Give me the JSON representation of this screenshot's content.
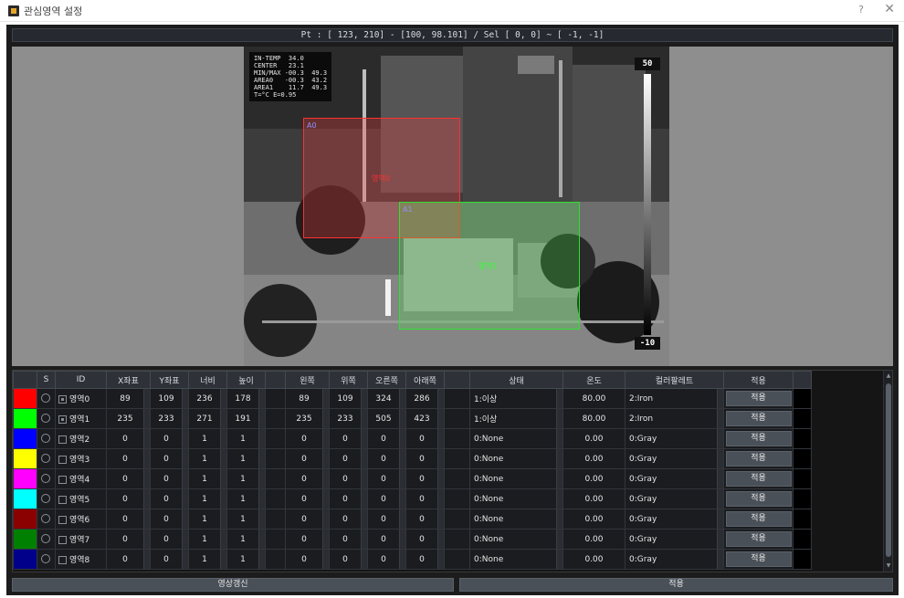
{
  "window": {
    "title": "관심영역 설정",
    "help_label": "?",
    "close_label": "✕"
  },
  "status": {
    "text": "Pt : [ 123, 210] - [100, 98.101] / Sel [   0,   0] ~ [  -1,  -1]"
  },
  "thermal": {
    "overlay_lines": "IN-TEMP  34.0\nCENTER   23.1\nMIN/MAX -00.3  49.3\nAREA0   -00.3  43.2\nAREA1    11.7  49.3\nT=°C E=0.95",
    "scale_max": "50",
    "scale_min": "-10",
    "roi0_label": "영역0",
    "roi1_label": "영역1",
    "roi0_tag": "A0",
    "roi1_tag": "A1"
  },
  "table": {
    "headers": [
      "",
      "S",
      "ID",
      "X좌표",
      "Y좌표",
      "너비",
      "높이",
      "",
      "왼쪽",
      "위쪽",
      "오른쪽",
      "아래쪽",
      "",
      "상태",
      "온도",
      "컬러팔레트",
      "적용",
      ""
    ],
    "rows": [
      {
        "color": "#ff0000",
        "checked": true,
        "id": "영역0",
        "x": "89",
        "y": "109",
        "w": "236",
        "h": "178",
        "left": "89",
        "top": "109",
        "right": "324",
        "bottom": "286",
        "state": "1:이상",
        "temp": "80.00",
        "palette": "2:Iron",
        "apply": "적용"
      },
      {
        "color": "#00ff00",
        "checked": true,
        "id": "영역1",
        "x": "235",
        "y": "233",
        "w": "271",
        "h": "191",
        "left": "235",
        "top": "233",
        "right": "505",
        "bottom": "423",
        "state": "1:이상",
        "temp": "80.00",
        "palette": "2:Iron",
        "apply": "적용"
      },
      {
        "color": "#0000ff",
        "checked": false,
        "id": "영역2",
        "x": "0",
        "y": "0",
        "w": "1",
        "h": "1",
        "left": "0",
        "top": "0",
        "right": "0",
        "bottom": "0",
        "state": "0:None",
        "temp": "0.00",
        "palette": "0:Gray",
        "apply": "적용"
      },
      {
        "color": "#ffff00",
        "checked": false,
        "id": "영역3",
        "x": "0",
        "y": "0",
        "w": "1",
        "h": "1",
        "left": "0",
        "top": "0",
        "right": "0",
        "bottom": "0",
        "state": "0:None",
        "temp": "0.00",
        "palette": "0:Gray",
        "apply": "적용"
      },
      {
        "color": "#ff00ff",
        "checked": false,
        "id": "영역4",
        "x": "0",
        "y": "0",
        "w": "1",
        "h": "1",
        "left": "0",
        "top": "0",
        "right": "0",
        "bottom": "0",
        "state": "0:None",
        "temp": "0.00",
        "palette": "0:Gray",
        "apply": "적용"
      },
      {
        "color": "#00ffff",
        "checked": false,
        "id": "영역5",
        "x": "0",
        "y": "0",
        "w": "1",
        "h": "1",
        "left": "0",
        "top": "0",
        "right": "0",
        "bottom": "0",
        "state": "0:None",
        "temp": "0.00",
        "palette": "0:Gray",
        "apply": "적용"
      },
      {
        "color": "#8b0000",
        "checked": false,
        "id": "영역6",
        "x": "0",
        "y": "0",
        "w": "1",
        "h": "1",
        "left": "0",
        "top": "0",
        "right": "0",
        "bottom": "0",
        "state": "0:None",
        "temp": "0.00",
        "palette": "0:Gray",
        "apply": "적용"
      },
      {
        "color": "#008000",
        "checked": false,
        "id": "영역7",
        "x": "0",
        "y": "0",
        "w": "1",
        "h": "1",
        "left": "0",
        "top": "0",
        "right": "0",
        "bottom": "0",
        "state": "0:None",
        "temp": "0.00",
        "palette": "0:Gray",
        "apply": "적용"
      },
      {
        "color": "#00008b",
        "checked": false,
        "id": "영역8",
        "x": "0",
        "y": "0",
        "w": "1",
        "h": "1",
        "left": "0",
        "top": "0",
        "right": "0",
        "bottom": "0",
        "state": "0:None",
        "temp": "0.00",
        "palette": "0:Gray",
        "apply": "적용"
      }
    ]
  },
  "buttons": {
    "refresh_video": "영상갱신",
    "apply_all": "적용"
  }
}
